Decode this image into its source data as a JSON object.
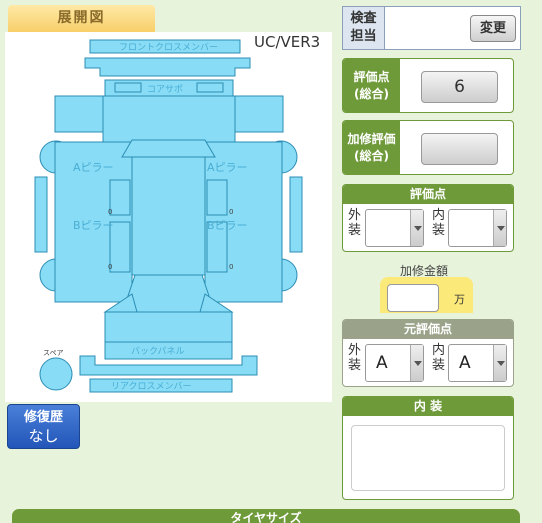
{
  "diagram": {
    "tab_title": "展開図",
    "version_label": "UC/VER3",
    "parts": {
      "front_cross_member": "フロントクロスメンバー",
      "core_support": "コアサポ",
      "a_pillar": "Aピラー",
      "b_pillar": "Bピラー",
      "back_panel": "バックパネル",
      "rear_cross_member": "リアクロスメンバー",
      "spare": "スペア",
      "dash_marker": "0"
    }
  },
  "repair_history": {
    "label": "修復歴",
    "value": "なし"
  },
  "inspector": {
    "label_line1": "検査",
    "label_line2": "担当",
    "change_button": "変更"
  },
  "overall_score": {
    "label_line1": "評価点",
    "label_line2": "(総合)",
    "value": "6"
  },
  "repair_score": {
    "label_line1": "加修評価",
    "label_line2": "(総合)",
    "value": ""
  },
  "score_section": {
    "title": "評価点",
    "exterior_label": "外装",
    "interior_label": "内装",
    "exterior_value": "",
    "interior_value": ""
  },
  "repair_amount": {
    "title": "加修金額",
    "value": "",
    "unit": "万"
  },
  "original_score": {
    "title": "元評価点",
    "exterior_label": "外装",
    "interior_label": "内装",
    "exterior_value": "A",
    "interior_value": "A"
  },
  "interior_section": {
    "title": "内 装",
    "text": ""
  },
  "tire_size": {
    "title": "タイヤサイズ"
  },
  "colors": {
    "green": "#6f9a3a",
    "part_fill": "#88dcf6",
    "part_stroke": "#2b8db3",
    "repair_blue": "#2356b8",
    "amount_yellow": "#fbe97a"
  }
}
